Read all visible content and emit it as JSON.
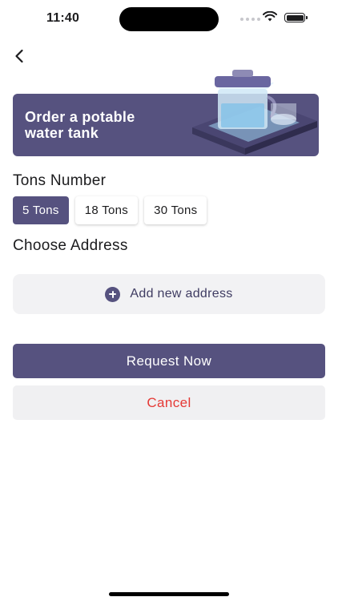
{
  "status_bar": {
    "time": "11:40"
  },
  "banner": {
    "title_line1": "Order a potable",
    "title_line2": "water tank"
  },
  "tons": {
    "label": "Tons Number",
    "options": [
      {
        "label": "5 Tons",
        "selected": true
      },
      {
        "label": "18 Tons",
        "selected": false
      },
      {
        "label": "30 Tons",
        "selected": false
      }
    ]
  },
  "address": {
    "label": "Choose Address",
    "add_label": "Add new address"
  },
  "actions": {
    "request_label": "Request Now",
    "cancel_label": "Cancel"
  },
  "colors": {
    "primary": "#56527f",
    "cancel_text": "#e53935",
    "surface": "#f2f2f4"
  }
}
